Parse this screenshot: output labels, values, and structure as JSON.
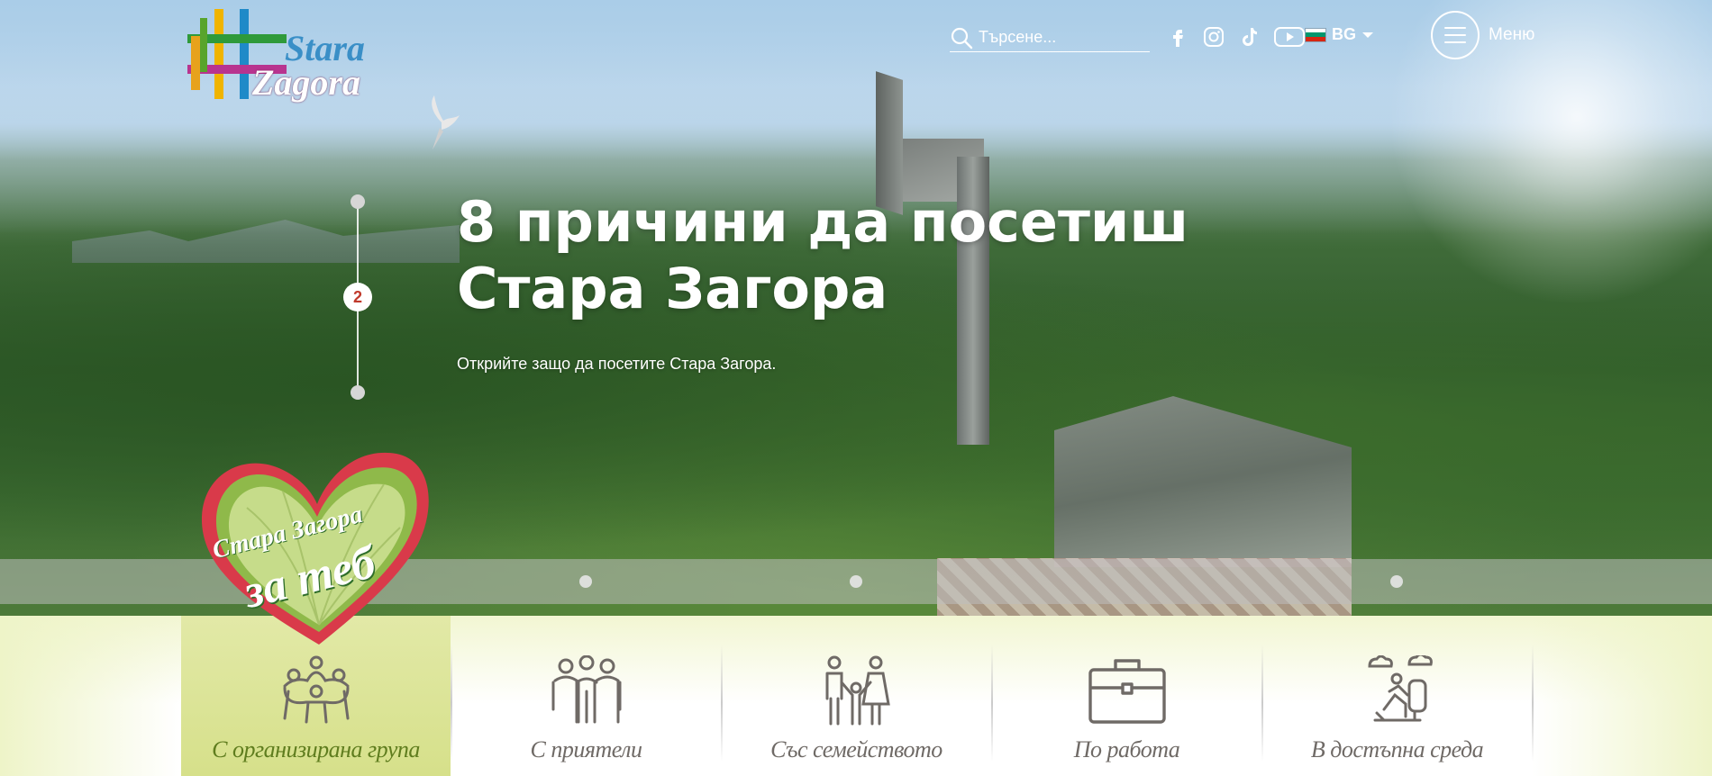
{
  "logo": {
    "line1": "Stara",
    "line2": "Zagora"
  },
  "search": {
    "placeholder": "Търсене..."
  },
  "social": [
    {
      "name": "facebook-icon"
    },
    {
      "name": "instagram-icon"
    },
    {
      "name": "tiktok-icon"
    },
    {
      "name": "youtube-icon"
    }
  ],
  "language": {
    "code": "BG"
  },
  "menu": {
    "label": "Меню"
  },
  "slider": {
    "current": "2",
    "title_line1": "8 причини да посетиш",
    "title_line2": "Стара Загора",
    "subtitle": "Открийте защо да посетите Стара Загора."
  },
  "badge": {
    "line1": "Стара Загора",
    "line2": "за теб"
  },
  "categories": [
    {
      "label": "С организирана група",
      "icon": "group-circle-icon",
      "active": true
    },
    {
      "label": "С приятели",
      "icon": "friends-icon",
      "active": false
    },
    {
      "label": "Със семейството",
      "icon": "family-icon",
      "active": false
    },
    {
      "label": "По работа",
      "icon": "briefcase-icon",
      "active": false
    },
    {
      "label": "В достъпна среда",
      "icon": "accessibility-icon",
      "active": false
    }
  ],
  "colors": {
    "accent_green": "#5f7d1e",
    "active_tab": "#d6e08a",
    "badge_red": "#d93a4a",
    "logo_blue": "#3a8fc7"
  }
}
